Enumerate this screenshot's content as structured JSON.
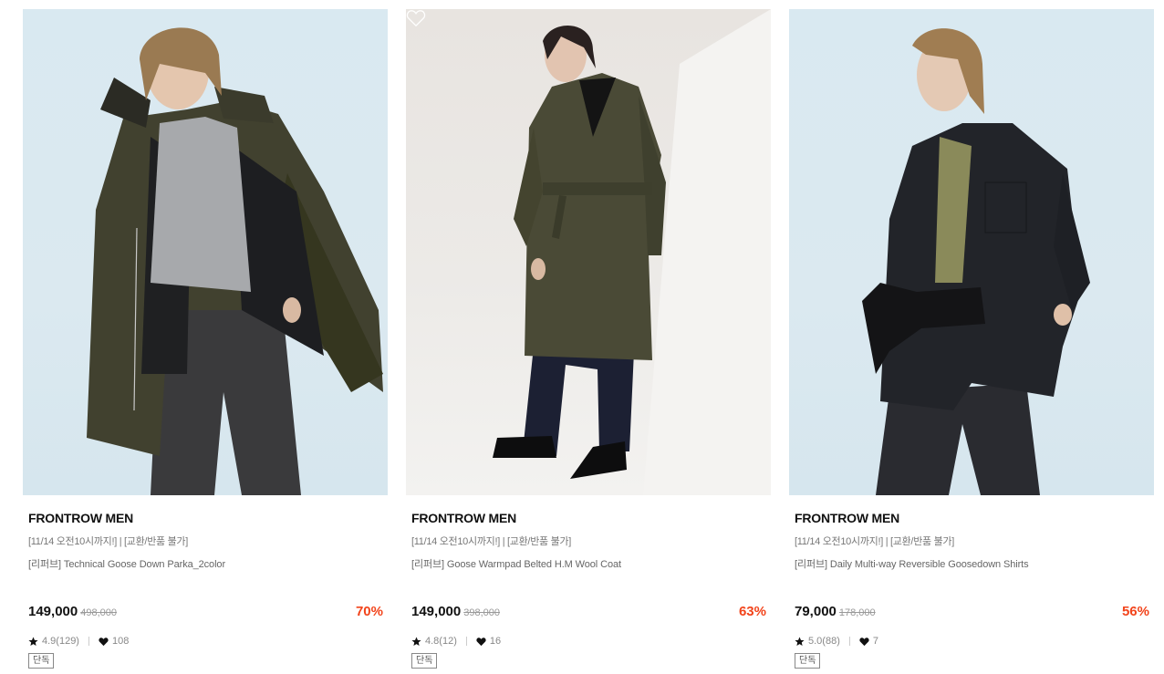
{
  "products": [
    {
      "brand": "FRONTROW MEN",
      "notice": "[11/14 오전10시까지!] | [교환/반품 불가]",
      "name": "[리퍼브] Technical Goose Down Parka_2color",
      "price": "149,000",
      "original_price": "498,000",
      "discount": "70%",
      "rating": "4.9(129)",
      "likes": "108",
      "badge": "단독",
      "image_background": "#d9e9f1"
    },
    {
      "brand": "FRONTROW MEN",
      "notice": "[11/14 오전10시까지!] | [교환/반품 불가]",
      "name": "[리퍼브] Goose Warmpad Belted H.M Wool Coat",
      "price": "149,000",
      "original_price": "398,000",
      "discount": "63%",
      "rating": "4.8(12)",
      "likes": "16",
      "badge": "단독",
      "image_background": "#ebe8e5"
    },
    {
      "brand": "FRONTROW MEN",
      "notice": "[11/14 오전10시까지!] | [교환/반품 불가]",
      "name": "[리퍼브] Daily Multi-way Reversible Goosedown Shirts",
      "price": "79,000",
      "original_price": "178,000",
      "discount": "56%",
      "rating": "5.0(88)",
      "likes": "7",
      "badge": "단독",
      "image_background": "#d9e9f1"
    }
  ],
  "icons": {
    "rating": "star-icon",
    "likes": "heart-icon",
    "wishlist": "heart-outline-icon"
  },
  "colors": {
    "discount": "#f2441b",
    "brand_text": "#111111",
    "muted_text": "#888888"
  }
}
